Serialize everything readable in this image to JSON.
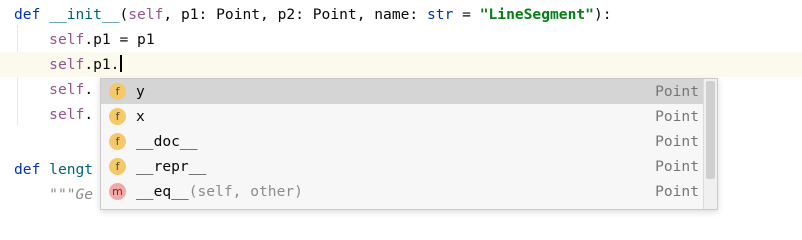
{
  "editor": {
    "lines": [
      {
        "kw": "def",
        "name": "__init__",
        "open": "(",
        "self": "self",
        "rest1": ", p1: Point, p2: Point, name: ",
        "type_kw": "str",
        "eq": " = ",
        "str": "\"LineSegment\"",
        "close": "):"
      },
      {
        "indent": "    ",
        "self": "self",
        "rest": ".p1 = p1"
      },
      {
        "indent": "    ",
        "self": "self",
        "rest": ".p1."
      },
      {
        "indent": "    ",
        "self": "self",
        "rest": "."
      },
      {
        "indent": "    ",
        "self": "self",
        "rest": "."
      },
      {
        "text": ""
      },
      {
        "kw": "def",
        "name": "lengt"
      },
      {
        "indent": "    ",
        "doc": "\"\"\"Ge"
      }
    ]
  },
  "completion": {
    "items": [
      {
        "kind": "f",
        "kind_icon": "field-icon",
        "name": "y",
        "signature": "",
        "type": "Point",
        "selected": true
      },
      {
        "kind": "f",
        "kind_icon": "field-icon",
        "name": "x",
        "signature": "",
        "type": "Point"
      },
      {
        "kind": "f",
        "kind_icon": "field-icon",
        "name": "__doc__",
        "signature": "",
        "type": "Point"
      },
      {
        "kind": "f",
        "kind_icon": "field-icon",
        "name": "__repr__",
        "signature": "",
        "type": "Point"
      },
      {
        "kind": "m",
        "kind_icon": "method-icon",
        "name": "__eq__",
        "signature": "(self, other)",
        "type": "Point"
      }
    ]
  },
  "colors": {
    "keyword": "#0033b3",
    "self": "#94558d",
    "string": "#067d17",
    "field_badge": "#f3c96b",
    "method_badge": "#f4a7a7",
    "selected_row": "#d5d5d5"
  }
}
